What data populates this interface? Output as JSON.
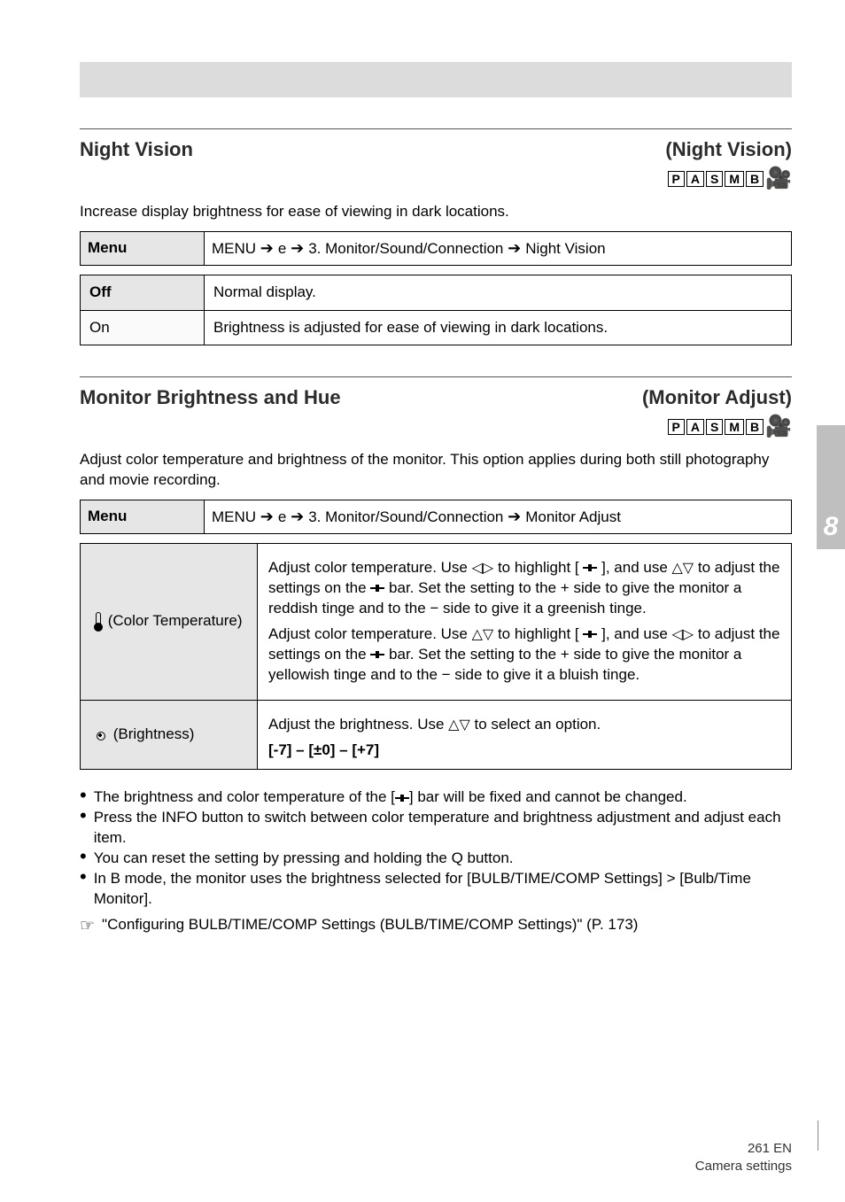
{
  "bands": {
    "top_band": ""
  },
  "section1": {
    "title": "Night Vision",
    "right": "(Night Vision)",
    "pasm": [
      "P",
      "A",
      "S",
      "M",
      "B"
    ],
    "desc": "Increase display brightness for ease of viewing in dark locations.",
    "menu": {
      "left": "Menu",
      "right_parts": [
        "MENU",
        "e",
        "3. Monitor/Sound/Connection",
        "Night Vision"
      ]
    },
    "rows": [
      {
        "opt": "Off",
        "text": "Normal display."
      },
      {
        "opt": "On",
        "text": "Brightness is adjusted for ease of viewing in dark locations."
      }
    ]
  },
  "section2": {
    "title": "Monitor Brightness and Hue",
    "right": "(Monitor Adjust)",
    "pasm": [
      "P",
      "A",
      "S",
      "M",
      "B"
    ],
    "desc": "Adjust color temperature and brightness of the monitor. This option applies during both still photography and movie recording.",
    "menu": {
      "left": "Menu",
      "right_parts": [
        "MENU",
        "e",
        "3. Monitor/Sound/Connection",
        "Monitor Adjust"
      ]
    },
    "rows": [
      {
        "label": "(Color Temperature)",
        "text_parts": [
          "Adjust color temperature. Use ",
          " to highlight [",
          "], and use ",
          " to adjust the settings on the ",
          " bar. Set the setting to the + side to give the monitor a reddish tinge and to the − side to give it a greenish tinge.",
          "Adjust color temperature. Use ",
          " to highlight [",
          "], and use ",
          " to adjust the settings on the ",
          " bar. Set the setting to the + side to give the monitor a yellowish tinge and to the − side to give it a bluish tinge."
        ]
      },
      {
        "label": "(Brightness)",
        "text": "Adjust the brightness. Use ",
        "text2": " to select an option.",
        "values": "[-7] – [±0] – [+7]"
      }
    ],
    "bullets": [
      "The brightness and color temperature of the [",
      "] bar will be fixed and cannot be changed.",
      "Press the INFO button to switch between color temperature and brightness adjustment and adjust each item.",
      "You can reset the setting by pressing and holding the Q button.",
      "In B mode, the monitor uses the brightness selected for [BULB/TIME/COMP Settings] > [Bulb/Time Monitor]."
    ],
    "ref": "\"Configuring BULB/TIME/COMP Settings (BULB/TIME/COMP Settings)\" (P. 173)"
  },
  "side_tab": "8",
  "footer": "261 EN\nCamera settings"
}
